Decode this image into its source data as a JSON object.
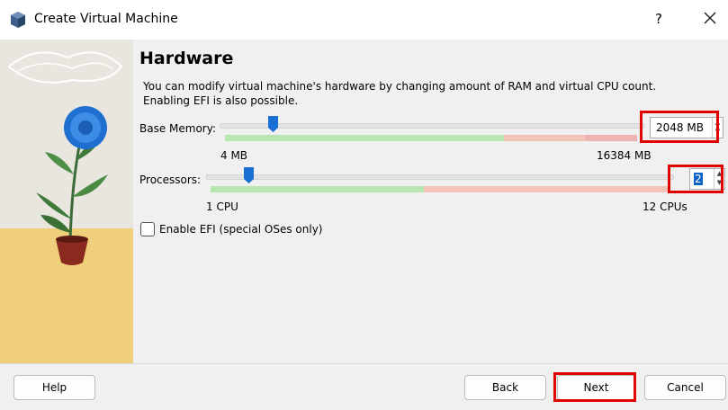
{
  "window": {
    "title": "Create Virtual Machine",
    "help_symbol": "?"
  },
  "page": {
    "heading": "Hardware",
    "description_line1": "You can modify virtual machine's hardware by changing amount of RAM and virtual CPU count.",
    "description_line2": "Enabling EFI is also possible."
  },
  "memory": {
    "label": "Base Memory:",
    "value": "2048 MB",
    "min_label": "4 MB",
    "max_label": "16384 MB",
    "level_fraction": 0.125
  },
  "processors": {
    "label": "Processors:",
    "value": "2",
    "min_label": "1 CPU",
    "max_label": "12 CPUs",
    "level_fraction": 0.09
  },
  "efi": {
    "label": "Enable EFI (special OSes only)",
    "checked": false
  },
  "buttons": {
    "help": "Help",
    "back": "Back",
    "next": "Next",
    "cancel": "Cancel"
  },
  "colors": {
    "thumb": "#1a6fd4",
    "highlight": "#e00000",
    "scale_green": "#b8e6b0",
    "scale_salmon": "#f3c4b8",
    "scale_red": "#eeb4b4"
  }
}
